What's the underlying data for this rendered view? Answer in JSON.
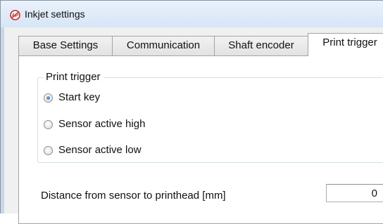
{
  "window": {
    "title": "Inkjet settings",
    "icon": "app-icon"
  },
  "tabs": [
    {
      "label": "Base Settings",
      "active": false
    },
    {
      "label": "Communication",
      "active": false
    },
    {
      "label": "Shaft encoder",
      "active": false
    },
    {
      "label": "Print trigger",
      "active": true
    }
  ],
  "print_trigger": {
    "group_label": "Print trigger",
    "options": [
      {
        "label": "Start key",
        "selected": true
      },
      {
        "label": "Sensor active high",
        "selected": false
      },
      {
        "label": "Sensor active low",
        "selected": false
      }
    ]
  },
  "distance_field": {
    "label": "Distance from sensor to printhead [mm]",
    "value": "0"
  },
  "colors": {
    "titlebar": "#dbe7f7",
    "radio_selected": "#1c5fb4",
    "frame_border": "#8a96a4"
  }
}
